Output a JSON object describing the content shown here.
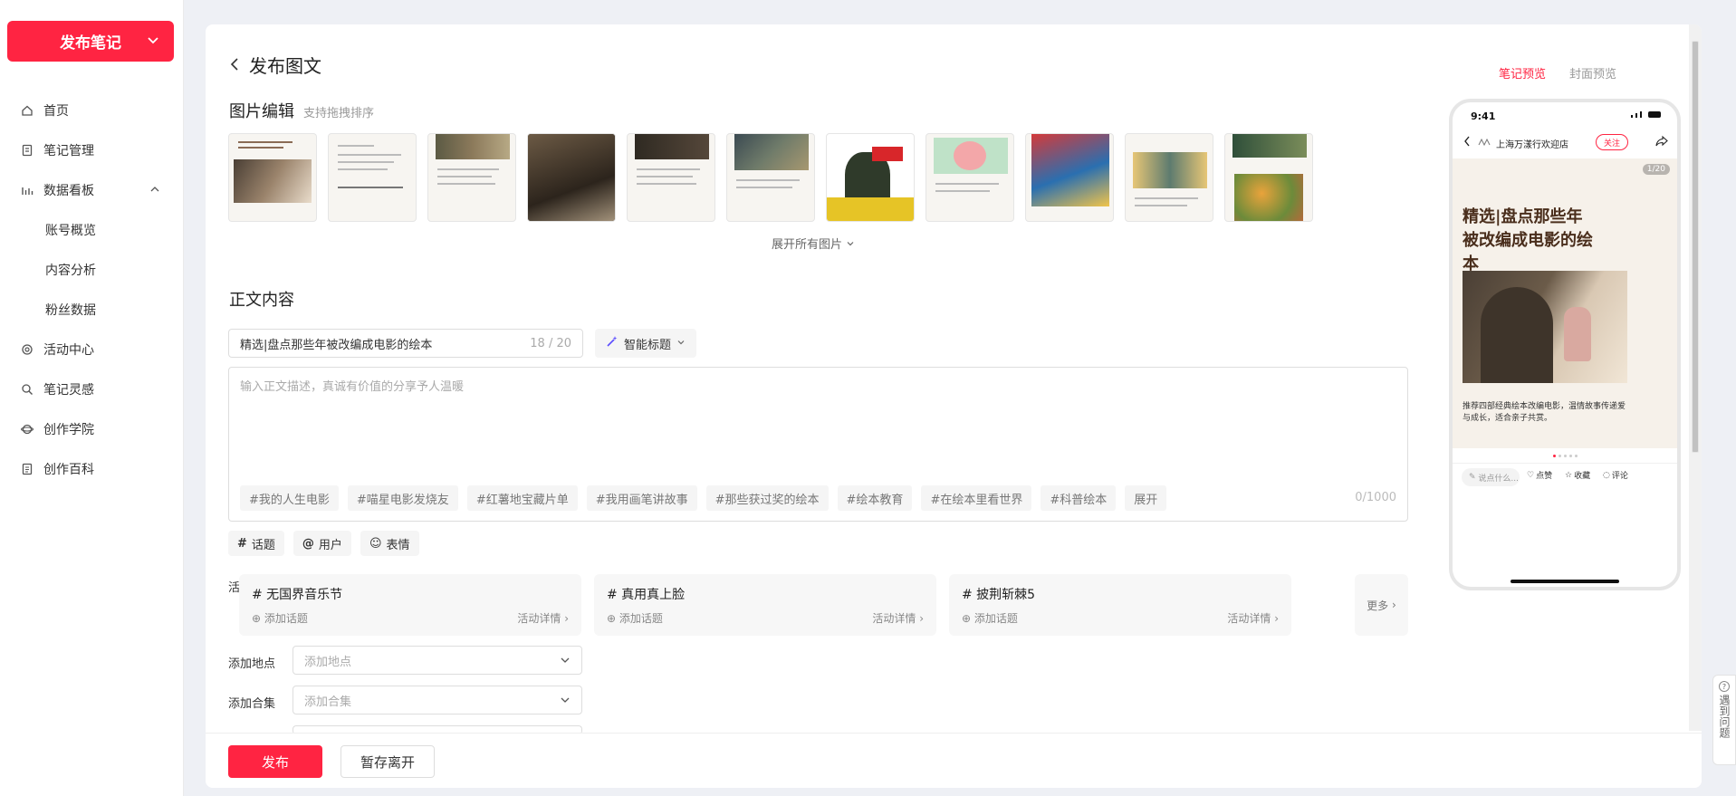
{
  "sidebar": {
    "publish_label": "发布笔记",
    "items": [
      {
        "label": "首页",
        "icon": "home-icon"
      },
      {
        "label": "笔记管理",
        "icon": "note-icon"
      },
      {
        "label": "数据看板",
        "icon": "chart-icon"
      },
      {
        "label": "账号概览"
      },
      {
        "label": "内容分析"
      },
      {
        "label": "粉丝数据"
      },
      {
        "label": "活动中心",
        "icon": "activity-icon"
      },
      {
        "label": "笔记灵感",
        "icon": "inspiration-icon"
      },
      {
        "label": "创作学院",
        "icon": "academy-icon"
      },
      {
        "label": "创作百科",
        "icon": "wiki-icon"
      }
    ]
  },
  "page": {
    "title": "发布图文",
    "image_section": "图片编辑",
    "image_hint": "支持拖拽排序",
    "expand_images": "展开所有图片",
    "body_section": "正文内容"
  },
  "editor": {
    "title_value": "精选|盘点那些年被改编成电影的绘本",
    "title_count": "18 / 20",
    "smart_title": "智能标题",
    "body_placeholder": "输入正文描述，真诚有价值的分享予人温暖",
    "body_count": "0/1000",
    "tags": [
      "#我的人生电影",
      "#喵星电影发烧友",
      "#红薯地宝藏片单",
      "#我用画笔讲故事",
      "#那些获过奖的绘本",
      "#绘本教育",
      "#在绘本里看世界",
      "#科普绘本",
      "展开"
    ],
    "tools": [
      {
        "icon": "#",
        "label": "话题"
      },
      {
        "icon": "@",
        "label": "用户"
      },
      {
        "icon": "☺",
        "label": "表情"
      }
    ]
  },
  "activities": {
    "label": "活动话题",
    "items": [
      {
        "name": "# 无国界音乐节",
        "add": "添加话题",
        "detail": "活动详情"
      },
      {
        "name": "# 真用真上脸",
        "add": "添加话题",
        "detail": "活动详情"
      },
      {
        "name": "# 披荆斩棘5",
        "add": "添加话题",
        "detail": "活动详情"
      }
    ],
    "more": "更多"
  },
  "location": {
    "label": "添加地点",
    "placeholder": "添加地点"
  },
  "collection": {
    "label": "添加合集",
    "placeholder": "添加合集"
  },
  "footer": {
    "publish": "发布",
    "save": "暂存离开"
  },
  "preview": {
    "tabs": [
      "笔记预览",
      "封面预览"
    ],
    "time": "9:41",
    "author": "上海万漾行欢迎店",
    "follow": "关注",
    "page_indicator": "1/20",
    "cover_title": "精选|盘点那些年被改编成电影的绘本",
    "caption": "推荐四部经典绘本改编电影，温情故事传递爱与成长，适合亲子共赏。",
    "say": "说点什么...",
    "like": "点赞",
    "collect": "收藏",
    "comment": "评论"
  },
  "help": {
    "label": "遇到问题"
  },
  "colors": {
    "accent": "#ff2442"
  }
}
